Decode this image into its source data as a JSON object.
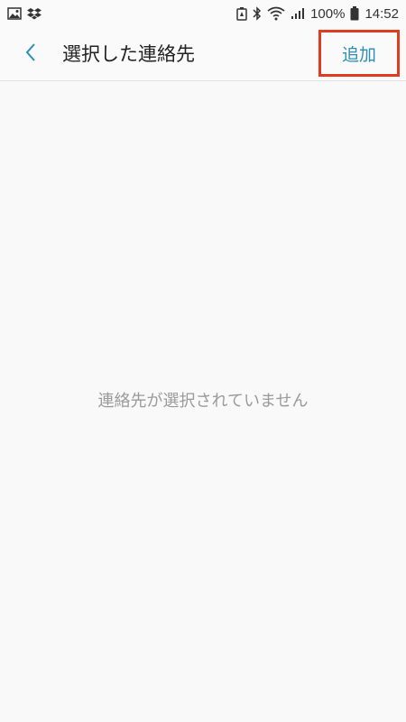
{
  "status_bar": {
    "battery_percent": "100%",
    "time": "14:52",
    "icons": [
      "gallery-icon",
      "dropbox-icon",
      "battery-saver-icon",
      "bluetooth-icon",
      "wifi-icon",
      "signal-icon",
      "battery-icon"
    ]
  },
  "header": {
    "back_icon": "chevron-left-icon",
    "title": "選択した連絡先",
    "add_label": "追加"
  },
  "main": {
    "empty_message": "連絡先が選択されていません"
  },
  "colors": {
    "accent": "#2b8fb8",
    "highlight_border": "#e23a1f",
    "background": "#f9f9f9"
  }
}
